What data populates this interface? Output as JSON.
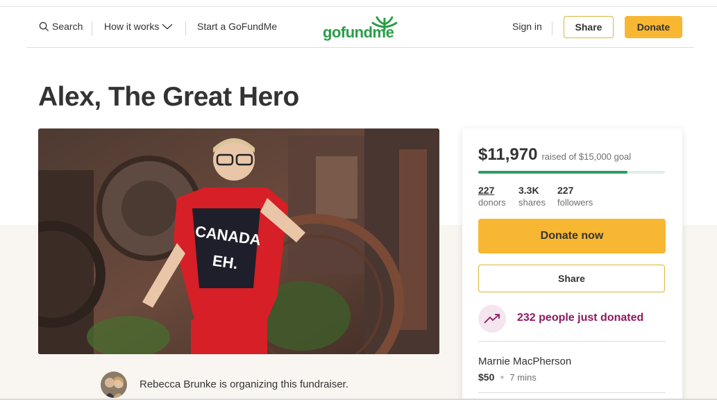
{
  "header": {
    "search_label": "Search",
    "how_it_works_label": "How it works",
    "start_label": "Start a GoFundMe",
    "logo_text": "gofundme",
    "sign_in_label": "Sign in",
    "share_label": "Share",
    "donate_label": "Donate"
  },
  "campaign": {
    "title": "Alex, The Great Hero",
    "organizer_text": "Rebecca Brunke is organizing this fundraiser."
  },
  "card": {
    "raised_amount": "$11,970",
    "raised_goal_text": "raised of $15,000 goal",
    "progress_fraction": 0.798,
    "stats": {
      "donors_num": "227",
      "donors_label": "donors",
      "shares_num": "3.3K",
      "shares_label": "shares",
      "followers_num": "227",
      "followers_label": "followers"
    },
    "donate_now_label": "Donate now",
    "share_label": "Share",
    "trend_text": "232 people just donated",
    "recent_donor": {
      "name": "Marnie MacPherson",
      "amount": "$50",
      "time": "7 mins"
    }
  },
  "colors": {
    "accent_yellow": "#f8b732",
    "progress_green": "#2a9d61",
    "logo_green": "#2a9d48",
    "trend_purple": "#8c1a60"
  }
}
